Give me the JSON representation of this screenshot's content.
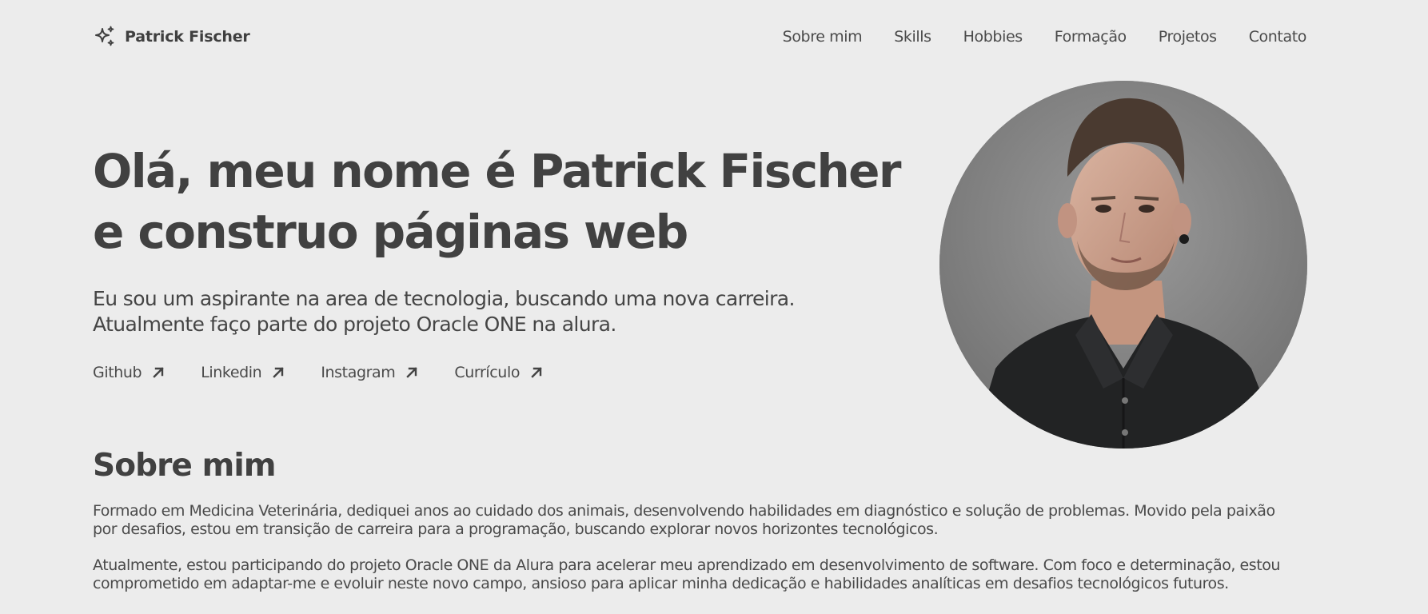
{
  "header": {
    "brand_name": "Patrick Fischer",
    "brand_icon": "sparkles-icon",
    "nav": [
      {
        "label": "Sobre mim"
      },
      {
        "label": "Skills"
      },
      {
        "label": "Hobbies"
      },
      {
        "label": "Formação"
      },
      {
        "label": "Projetos"
      },
      {
        "label": "Contato"
      }
    ]
  },
  "hero": {
    "title_line1": "Olá, meu nome é Patrick Fischer",
    "title_line2": "e construo páginas web",
    "subtitle_line1": "Eu sou um aspirante na area de tecnologia, buscando uma nova carreira.",
    "subtitle_line2": "Atualmente faço parte do projeto Oracle ONE na alura.",
    "links": [
      {
        "label": "Github",
        "icon": "arrow-up-right-icon"
      },
      {
        "label": "Linkedin",
        "icon": "arrow-up-right-icon"
      },
      {
        "label": "Instagram",
        "icon": "arrow-up-right-icon"
      },
      {
        "label": "Currículo",
        "icon": "arrow-up-right-icon"
      }
    ],
    "portrait_icon": "profile-photo"
  },
  "about": {
    "title": "Sobre mim",
    "p1_line1": "Formado em Medicina Veterinária, dediquei anos ao cuidado dos animais, desenvolvendo habilidades em diagnóstico e solução de problemas. Movido pela paixão",
    "p1_line2": "por desafios, estou em transição de carreira para a programação, buscando explorar novos horizontes tecnológicos.",
    "p2_line1": "Atualmente, estou participando do projeto Oracle ONE da Alura para acelerar meu aprendizado em desenvolvimento de software. Com foco e determinação, estou",
    "p2_line2": "comprometido em adaptar-me e evoluir neste novo campo, ansioso para aplicar minha dedicação e habilidades analíticas em desafios tecnológicos futuros."
  },
  "colors": {
    "background": "#ececec",
    "text": "#444444"
  }
}
